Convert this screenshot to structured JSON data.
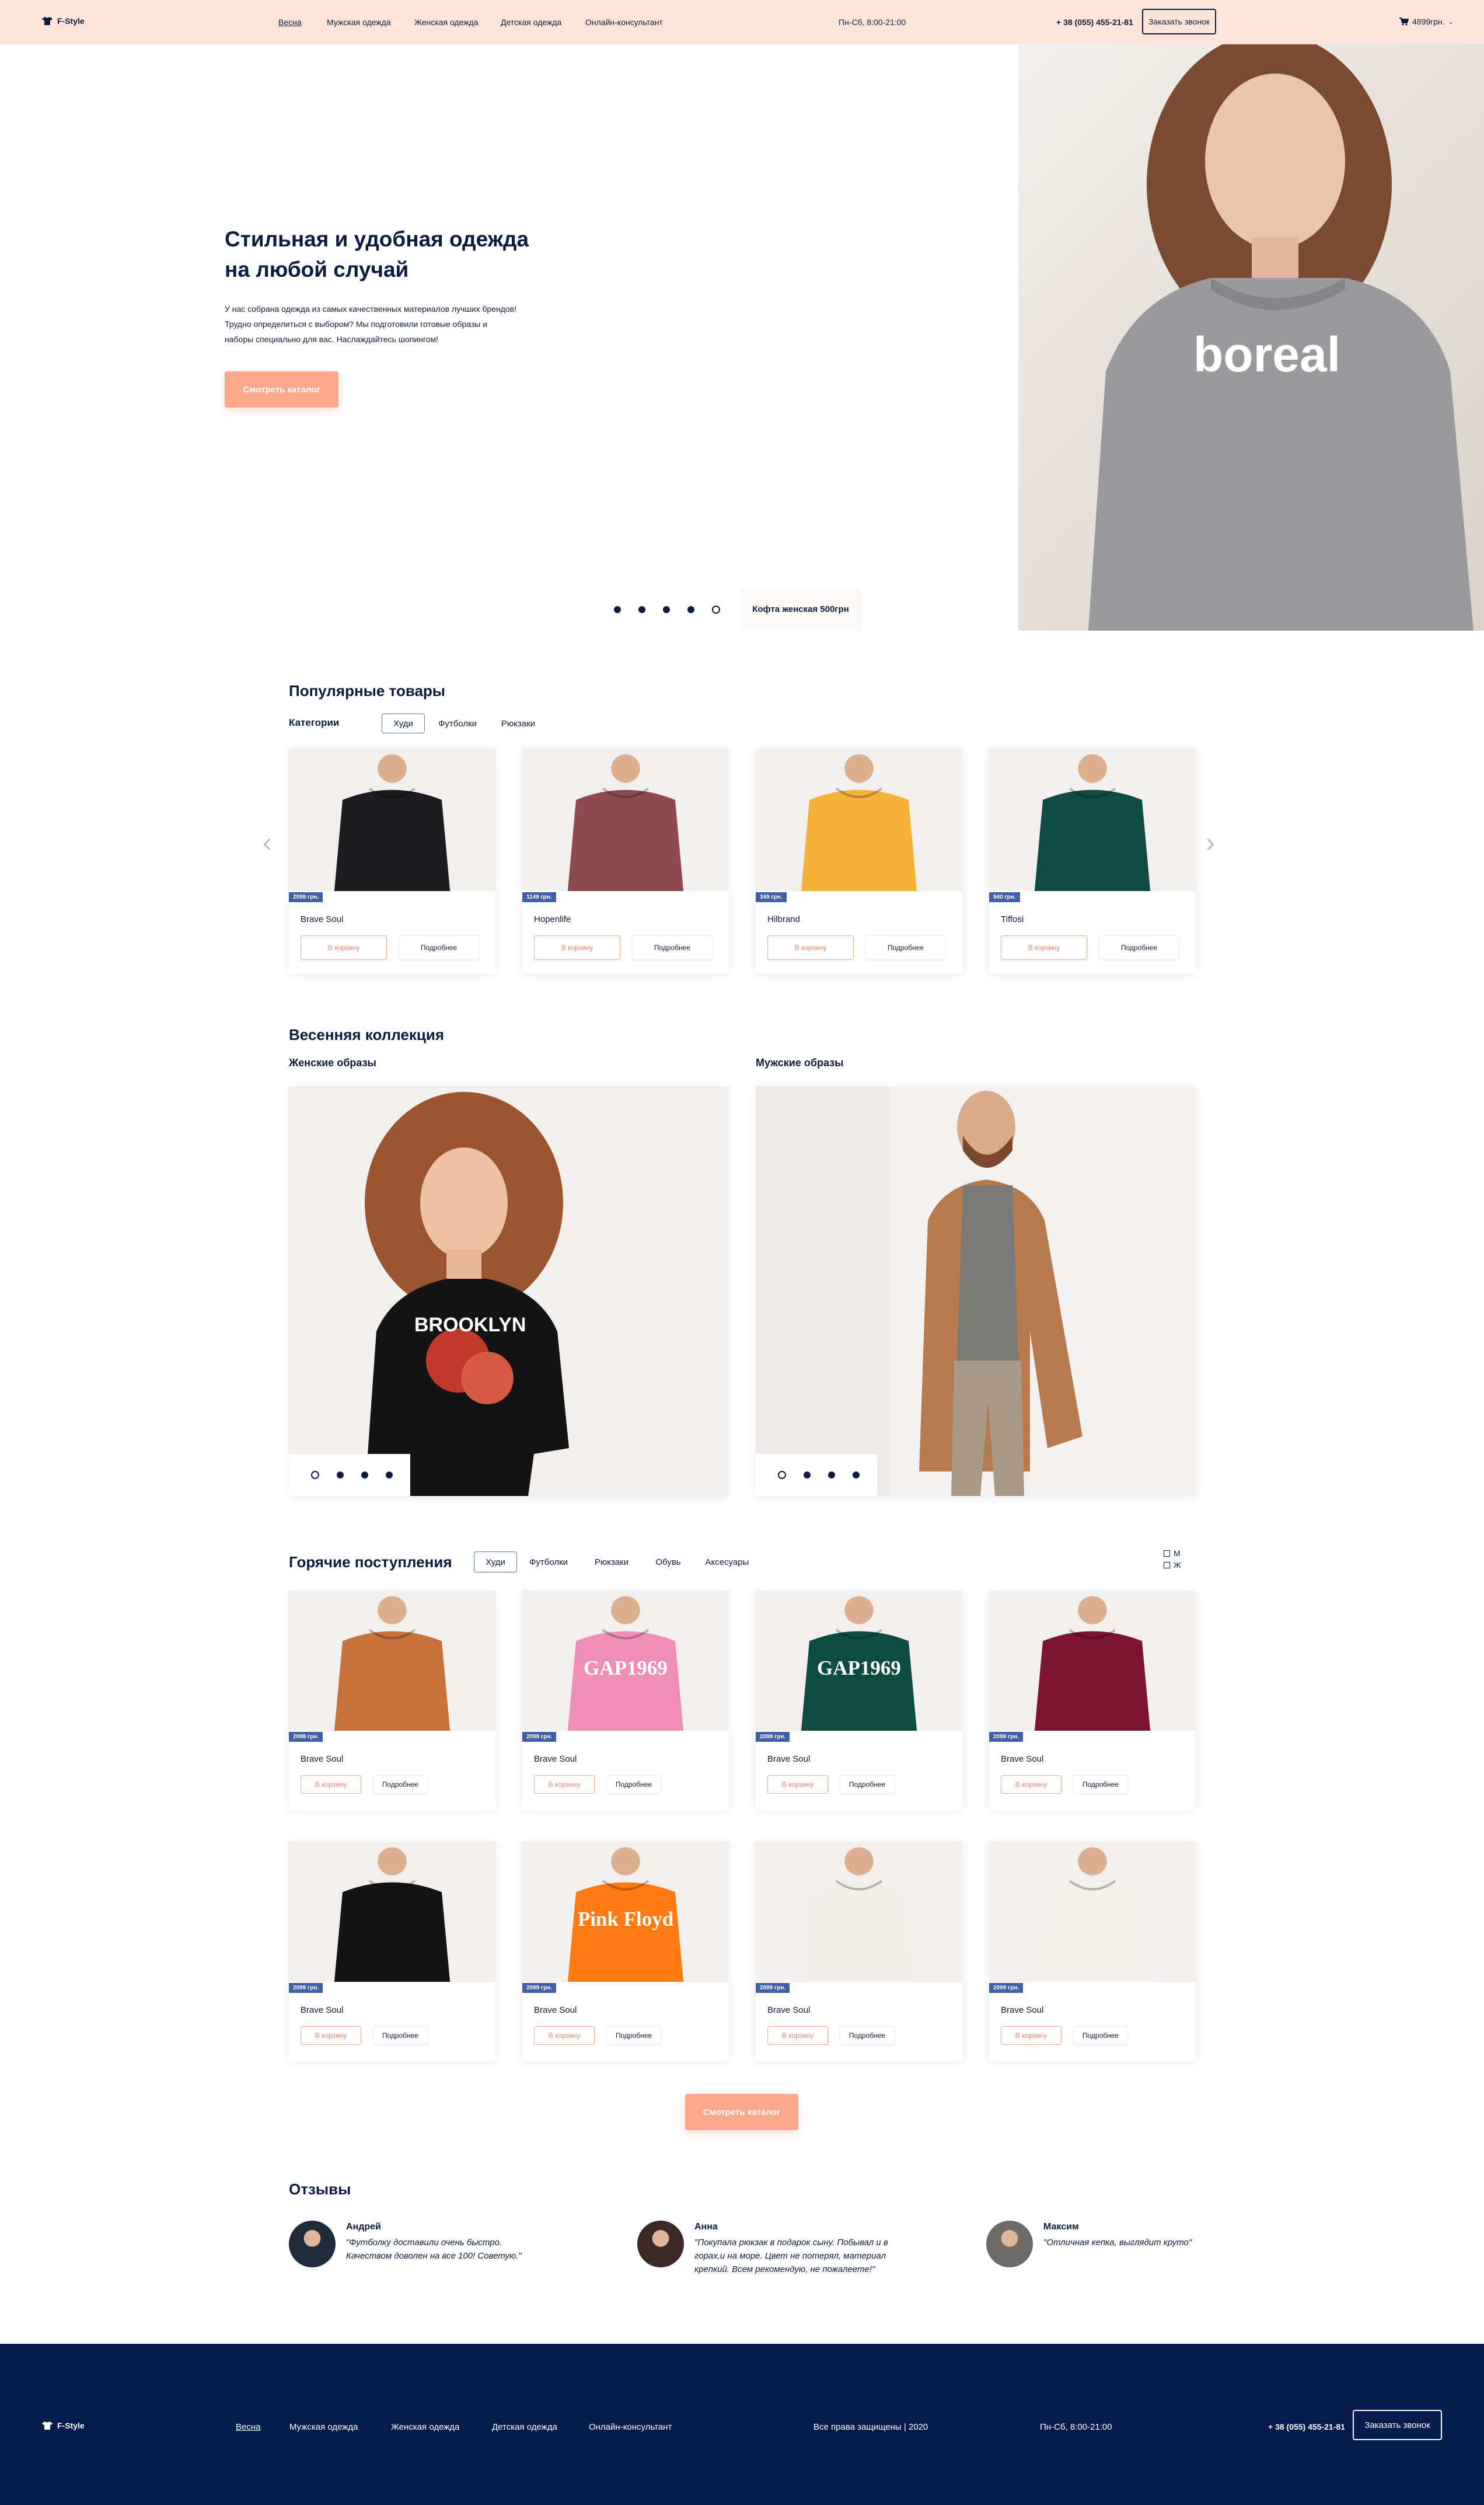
{
  "header": {
    "logo_text": "F-Style",
    "nav": [
      "Весна",
      "Мужская одежда",
      "Женская одежда",
      "Детская одежда",
      "Онлайн-консультант"
    ],
    "hours": "Пн-Сб, 8:00-21:00",
    "phone": "+ 38 (055) 455-21-81",
    "callback_label": "Заказать звонок",
    "cart_total": "4899грн."
  },
  "hero": {
    "title_line1": "Стильная и удобная одежда",
    "title_line2": "на любой случай",
    "desc_line1": "У нас собрана одежда из самых качественных материалов лучших брендов!",
    "desc_line2": "Трудно определиться с выбором? Мы подготовили готовые образы и",
    "desc_line3": "наборы специально для вас. Наслаждайтесь шопингом!",
    "cta_label": "Смотреть каталог",
    "slide_caption": "Кофта женская 500грн",
    "image_text": "boreal",
    "active_slide": 4,
    "slides_total": 5
  },
  "popular": {
    "title": "Популярные товары",
    "categories_label": "Категории",
    "tabs": [
      "Худи",
      "Футболки",
      "Рюкзаки"
    ],
    "cart_label": "В корзину",
    "more_label": "Подробнее",
    "products": [
      {
        "price": "2099 грн.",
        "brand": "Brave Soul",
        "color": "#1c1c1e"
      },
      {
        "price": "1149 грн.",
        "brand": "Hopenlife",
        "color": "#8f4a4f"
      },
      {
        "price": "349 грн.",
        "brand": "Hilbrand",
        "color": "#f4b23a"
      },
      {
        "price": "940 грн.",
        "brand": "Tiffosi",
        "color": "#0f4a44"
      }
    ]
  },
  "spring": {
    "title": "Весенняя коллекция",
    "women_label": "Женские образы",
    "men_label": "Мужские образы",
    "tshirt_text": "BROOKLYN"
  },
  "hot": {
    "title": "Горячие поступления",
    "tabs": [
      "Худи",
      "Футболки",
      "Рюкзаки",
      "Обувь",
      "Аксесуары"
    ],
    "filter_m": "М",
    "filter_f": "Ж",
    "cart_label": "В корзину",
    "more_label": "Подробнее",
    "products": [
      {
        "price": "2099 грн.",
        "brand": "Brave Soul",
        "color": "#c7713b",
        "print": ""
      },
      {
        "price": "2099 грн.",
        "brand": "Brave Soul",
        "color": "#ef8fb7",
        "print": "GAP1969"
      },
      {
        "price": "2099 грн.",
        "brand": "Brave Soul",
        "color": "#0e4b43",
        "print": "GAP1969"
      },
      {
        "price": "2099 грн.",
        "brand": "Brave Soul",
        "color": "#7e1530",
        "print": ""
      },
      {
        "price": "2099 грн.",
        "brand": "Brave Soul",
        "color": "#141414",
        "print": ""
      },
      {
        "price": "2099 грн.",
        "brand": "Brave Soul",
        "color": "#ff7a12",
        "print": "Pink Floyd"
      },
      {
        "price": "2099 грн.",
        "brand": "Brave Soul",
        "color": "#f2efe8",
        "print": ""
      },
      {
        "price": "2099 грн.",
        "brand": "Brave Soul",
        "color": "#f4f1ea",
        "print": ""
      }
    ],
    "cta_label": "Смотреть каталог"
  },
  "reviews": {
    "title": "Отзывы",
    "items": [
      {
        "name": "Андрей",
        "line1": "\"Футболку доставили очень быстро.",
        "line2": "Качеством доволен на все 100! Советую.\"",
        "line3": ""
      },
      {
        "name": "Анна",
        "line1": "\"Покупала рюкзак в подарок сыну. Побывал и в",
        "line2": "горах,и на море. Цвет не потерял, материал",
        "line3": "крепкий. Всем рекомендую, не пожалеете!\""
      },
      {
        "name": "Максим",
        "line1": "\"Отличная кепка, выглядит круто\"",
        "line2": "",
        "line3": ""
      }
    ]
  },
  "footer": {
    "logo_text": "F-Style",
    "nav": [
      "Весна",
      "Мужская одежда",
      "Женская одежда",
      "Детская одежда",
      "Онлайн-консультант"
    ],
    "copyright": "Все права защищены | 2020",
    "hours": "Пн-Сб, 8:00-21:00",
    "phone": "+ 38 (055) 455-21-81",
    "callback_label": "Заказать звонок"
  }
}
